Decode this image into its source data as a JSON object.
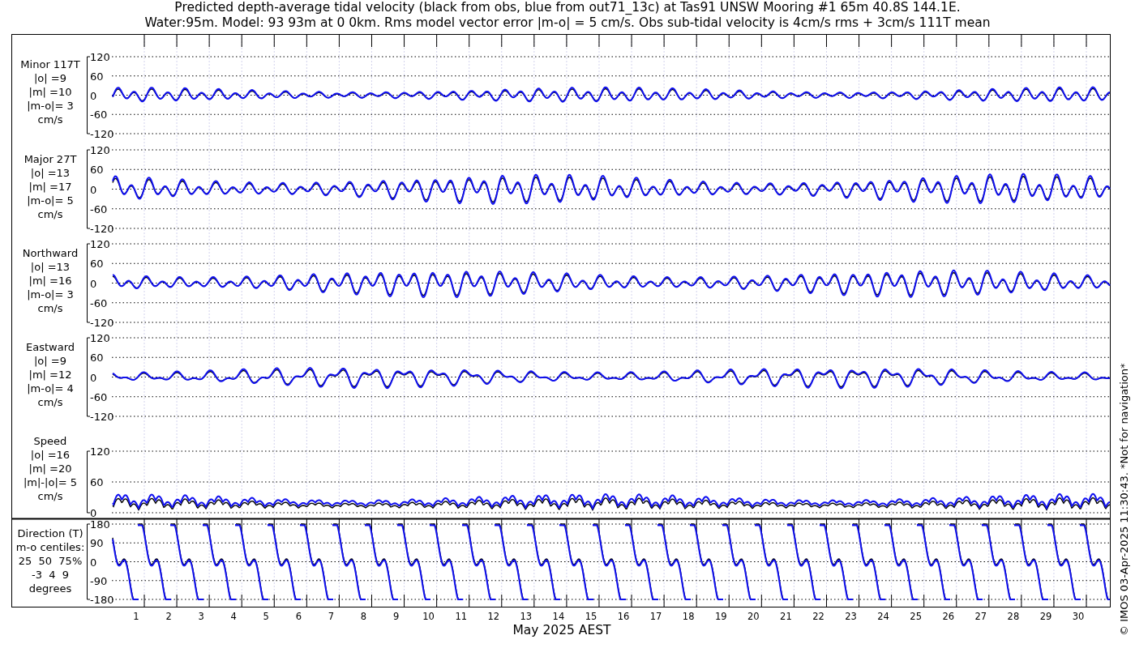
{
  "title_lines": [
    "Predicted depth-average tidal velocity (black from obs, blue from out71_13c) at Tas91 UNSW Mooring #1 65m 40.8S 144.1E.",
    "Water:95m. Model: 93 93m at 0 0km. Rms model vector error |m-o| = 5 cm/s. Obs sub-tidal velocity is 4cm/s rms + 3cm/s 111T mean"
  ],
  "panels": [
    {
      "kind": "velocity",
      "label_lines": [
        "Minor 117T",
        "|o| =9",
        "|m| =10",
        "|m-o|= 3",
        "cm/s"
      ],
      "yticks": [
        "120",
        "60",
        "0",
        "-60",
        "-120"
      ]
    },
    {
      "kind": "velocity",
      "label_lines": [
        "Major 27T",
        "|o| =13",
        "|m| =17",
        "|m-o|= 5",
        "cm/s"
      ],
      "yticks": [
        "120",
        "60",
        "0",
        "-60",
        "-120"
      ]
    },
    {
      "kind": "velocity",
      "label_lines": [
        "Northward",
        "|o| =13",
        "|m| =16",
        "|m-o|= 3",
        "cm/s"
      ],
      "yticks": [
        "120",
        "60",
        "0",
        "-60",
        "-120"
      ]
    },
    {
      "kind": "velocity",
      "label_lines": [
        "Eastward",
        "|o| =9",
        "|m| =12",
        "|m-o|= 4",
        "cm/s"
      ],
      "yticks": [
        "120",
        "60",
        "0",
        "-60",
        "-120"
      ]
    },
    {
      "kind": "speed",
      "label_lines": [
        "Speed",
        "|o| =16",
        "|m| =20",
        "|m|-|o|= 5",
        "cm/s"
      ],
      "yticks": [
        "120",
        "60",
        "0"
      ]
    },
    {
      "kind": "direction",
      "label_lines": [
        "Direction (T)",
        "m-o centiles:",
        "25  50  75%",
        "-3  4  9",
        "degrees"
      ],
      "yticks": [
        "180",
        "90",
        "0",
        "-90",
        "-180"
      ]
    }
  ],
  "x_tick_labels": [
    "1",
    "2",
    "3",
    "4",
    "5",
    "6",
    "7",
    "8",
    "9",
    "10",
    "11",
    "12",
    "13",
    "14",
    "15",
    "16",
    "17",
    "18",
    "19",
    "20",
    "21",
    "22",
    "23",
    "24",
    "25",
    "26",
    "27",
    "28",
    "29",
    "30"
  ],
  "xlabel": "May 2025 AEST",
  "credit": "© IMOS 03-Apr-2025 11:30:43. *Not for navigation*"
}
